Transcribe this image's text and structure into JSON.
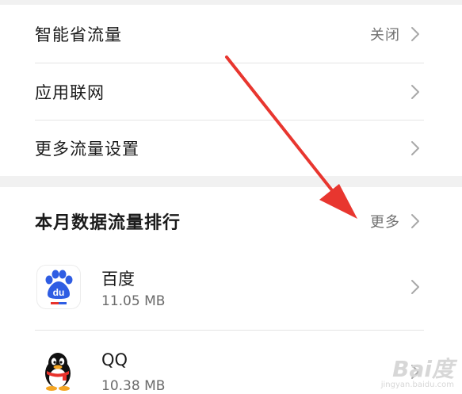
{
  "settings": {
    "smart_saver": {
      "label": "智能省流量",
      "value": "关闭"
    },
    "app_network": {
      "label": "应用联网"
    },
    "more_settings": {
      "label": "更多流量设置"
    }
  },
  "ranking": {
    "title": "本月数据流量排行",
    "more_label": "更多",
    "apps": [
      {
        "name": "百度",
        "size": "11.05 MB",
        "icon": "baidu-app-icon"
      },
      {
        "name": "QQ",
        "size": "10.38 MB",
        "icon": "qq-penguin-icon"
      }
    ]
  },
  "baidu_icon_text": "du",
  "watermark": {
    "brand": "Bai度",
    "site": "jingyan.baidu.com"
  },
  "colors": {
    "accent_blue": "#2f5de3",
    "baidu_red": "#e8322b",
    "arrow_red": "#e8362f"
  }
}
